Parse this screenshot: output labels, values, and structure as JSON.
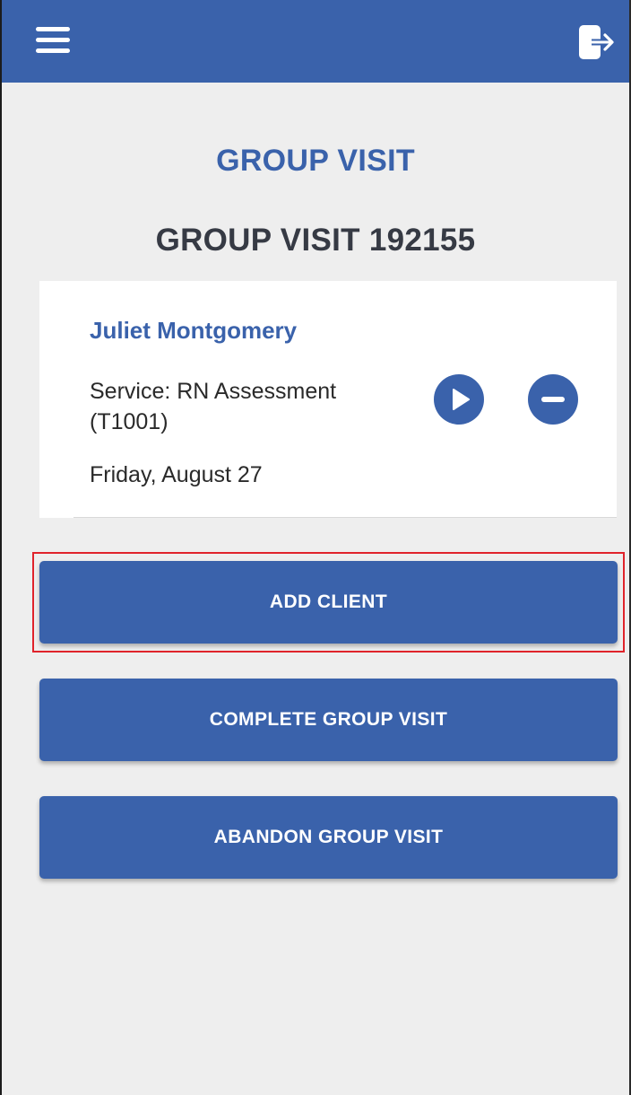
{
  "header": {
    "menu_icon": "hamburger-menu-icon",
    "logout_icon": "logout-icon",
    "bar_color": "#3a62ab"
  },
  "page": {
    "heading": "GROUP VISIT",
    "visit_title": "GROUP VISIT 192155"
  },
  "client": {
    "name": "Juliet Montgomery",
    "service": "Service: RN Assessment (T1001)",
    "date": "Friday, August 27",
    "start_icon": "play-icon",
    "remove_icon": "minus-icon"
  },
  "actions": {
    "add_client": "ADD CLIENT",
    "complete": "COMPLETE GROUP VISIT",
    "abandon": "ABANDON GROUP VISIT"
  },
  "colors": {
    "accent": "#3a62ab",
    "background": "#eeeeee",
    "highlight": "#e0232b"
  }
}
